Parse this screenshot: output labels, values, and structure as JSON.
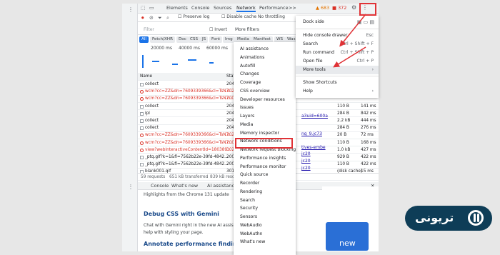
{
  "toolbar": {
    "tabs": [
      "Elements",
      "Console",
      "Sources",
      "Network",
      "Performance",
      ">>"
    ],
    "warn": "683",
    "err": "372"
  },
  "controls": {
    "preserve": "Preserve log",
    "disable": "Disable cache",
    "throttle": "No throttling"
  },
  "filter": {
    "placeholder": "Filter",
    "invert": "Invert",
    "more": "More filters"
  },
  "chips": [
    "All",
    "Fetch/XHR",
    "Doc",
    "CSS",
    "JS",
    "Font",
    "Img",
    "Media",
    "Manifest",
    "WS",
    "Wasm"
  ],
  "timeline": [
    "20000 ms",
    "40000 ms",
    "60000 ms"
  ],
  "cols": {
    "name": "Name",
    "status": "Stat"
  },
  "rows": [
    {
      "name": "collect",
      "status": "204",
      "size": "",
      "time": ""
    },
    {
      "name": "wcm?cc=ZZ&dn=7609339366&cl=TsN7...",
      "status": "302",
      "size": "",
      "time": ""
    },
    {
      "name": "wcm?cc=ZZ&dn=7609339366&cl=TsN7...",
      "status": "200",
      "size": "",
      "time": ""
    },
    {
      "name": "collect",
      "status": "204",
      "size": "110 B",
      "time": "141 ms"
    },
    {
      "name": "ipl",
      "status": "204",
      "size": "284 B",
      "time": "842 ms"
    },
    {
      "name": "collect",
      "status": "204",
      "size": "2.2 kB",
      "time": "444 ms"
    },
    {
      "name": "collect",
      "status": "204",
      "size": "284 B",
      "time": "276 ms"
    },
    {
      "name": "wcm?cc=ZZ&dn=7609339366&cl=TsN7...",
      "status": "302",
      "size": "20 B",
      "time": "72 ms"
    },
    {
      "name": "wcm?cc=ZZ&dn=7609339366&cl=TsN7...",
      "status": "200",
      "size": "110 B",
      "time": "168 ms"
    },
    {
      "name": "view?webInteractiveContentId=180389...",
      "status": "302",
      "size": "1.0 kB",
      "time": "427 ms"
    },
    {
      "name": "_ptq.gif?k=1&fl=7562b22e-39fd-4842...",
      "status": "200",
      "size": "929 B",
      "time": "422 ms"
    },
    {
      "name": "_ptq.gif?k=1&fl=7562b22e-39fd-4842...",
      "status": "200",
      "size": "110 B",
      "time": "422 ms"
    },
    {
      "name": "blank001.gif",
      "status": "301",
      "size": "(disk cache)",
      "time": "15 ms"
    }
  ],
  "rowsExtra": [
    "a3uid=600a",
    "ng_9.jc73",
    "tives-embe",
    "jc20",
    "jc20",
    "jc20"
  ],
  "summary": {
    "req": "59 requests",
    "xfer": "651 kB transferred",
    "res": "839 kB resou"
  },
  "drawer": {
    "tabs": [
      "Console",
      "What's new",
      "AI assistance"
    ],
    "highlight": "Highlights from the Chrome 131 update",
    "h1": "Debug CSS with Gemini",
    "p1": "Chat with Gemini right in the new AI assistance p",
    "p2": "help with styling your page.",
    "h2": "Annotate performance findings"
  },
  "menuMore": [
    "AI assistance",
    "Animations",
    "Autofill",
    "Changes",
    "Coverage",
    "CSS overview",
    "Developer resources",
    "Issues",
    "Layers",
    "Media",
    "Memory inspector",
    "Network conditions",
    "Network request blocking",
    "Performance insights",
    "Performance monitor",
    "Quick source",
    "Recorder",
    "Rendering",
    "Search",
    "Security",
    "Sensors",
    "WebAudio",
    "WebAuthn",
    "What's new"
  ],
  "menuMain": {
    "dock": "Dock side",
    "hide": "Hide console drawer",
    "hideK": "Esc",
    "search": "Search",
    "searchK": "Ctrl + Shift + F",
    "run": "Run command",
    "runK": "Ctrl + Shift + P",
    "open": "Open file",
    "openK": "Ctrl + P",
    "more": "More tools",
    "shortcuts": "Show Shortcuts",
    "help": "Help"
  },
  "logo": {
    "text": "تریونی"
  },
  "colors": {
    "accent": "#1a73e8",
    "highlight": "#e03236",
    "logoBg": "#0e3d57"
  }
}
